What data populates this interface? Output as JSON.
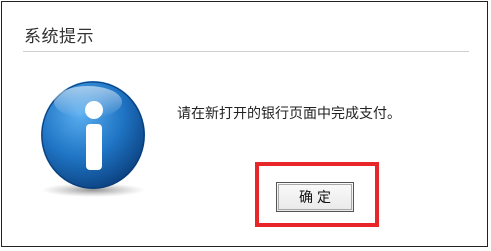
{
  "dialog": {
    "title": "系统提示",
    "message": "请在新打开的银行页面中完成支付。",
    "icon": "info-icon",
    "ok_label": "确定",
    "highlight_color": "#e8262a"
  }
}
